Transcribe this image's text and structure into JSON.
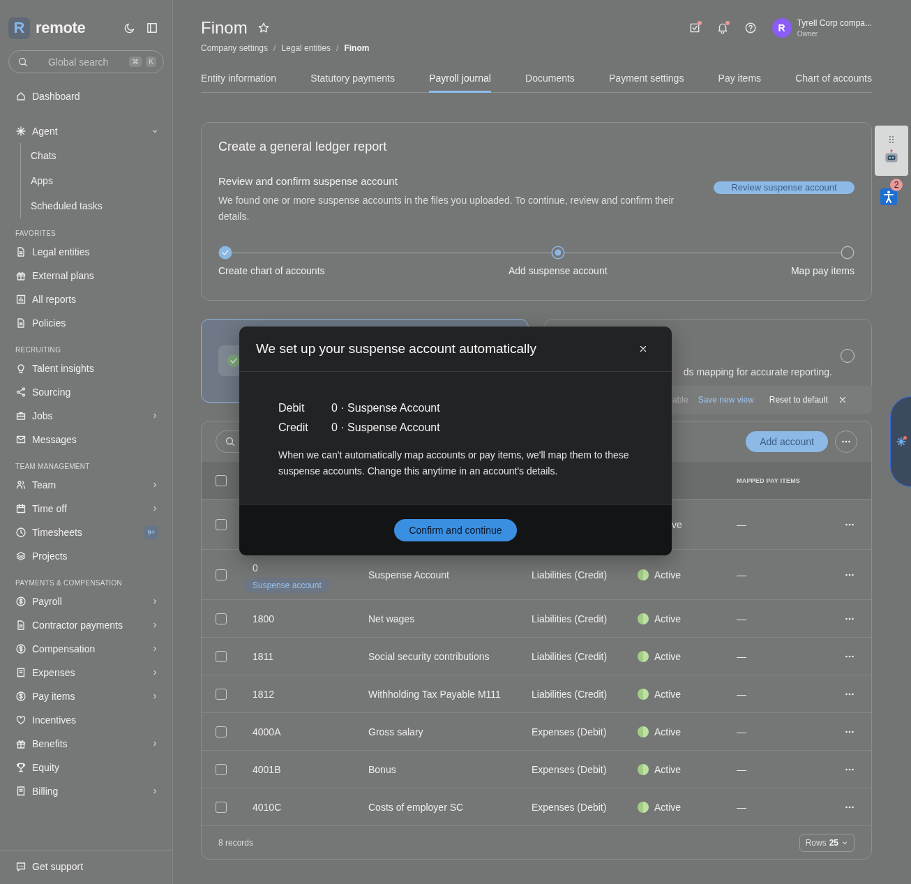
{
  "sidebar": {
    "brand": {
      "logo_letter": "R",
      "name": "remote"
    },
    "search": {
      "placeholder": "Global search",
      "keys": [
        "⌘",
        "K"
      ]
    },
    "sections": [
      {
        "items": [
          {
            "label": "Dashboard",
            "submenu": false
          }
        ]
      },
      {
        "items": [
          {
            "label": "Agent",
            "expanded": true,
            "children": [
              {
                "label": "Chats"
              },
              {
                "label": "Apps"
              },
              {
                "label": "Scheduled tasks"
              }
            ]
          }
        ]
      },
      {
        "heading": "FAVORITES",
        "items": [
          {
            "label": "Legal entities",
            "submenu": false
          },
          {
            "label": "External plans",
            "submenu": false
          },
          {
            "label": "All reports",
            "submenu": false
          },
          {
            "label": "Policies",
            "submenu": false
          }
        ]
      },
      {
        "heading": "RECRUITING",
        "items": [
          {
            "label": "Talent insights",
            "submenu": false
          },
          {
            "label": "Sourcing",
            "submenu": false
          },
          {
            "label": "Jobs",
            "submenu": true
          },
          {
            "label": "Messages",
            "submenu": false
          }
        ]
      },
      {
        "heading": "TEAM MANAGEMENT",
        "items": [
          {
            "label": "Team",
            "submenu": true
          },
          {
            "label": "Time off",
            "submenu": true
          },
          {
            "label": "Timesheets",
            "submenu": false,
            "badge": "9+"
          },
          {
            "label": "Projects",
            "submenu": false
          }
        ]
      },
      {
        "heading": "PAYMENTS & COMPENSATION",
        "items": [
          {
            "label": "Payroll",
            "submenu": true
          },
          {
            "label": "Contractor payments",
            "submenu": true
          },
          {
            "label": "Compensation",
            "submenu": true
          },
          {
            "label": "Expenses",
            "submenu": true
          },
          {
            "label": "Pay items",
            "submenu": true
          },
          {
            "label": "Incentives",
            "submenu": false
          },
          {
            "label": "Benefits",
            "submenu": true
          },
          {
            "label": "Equity",
            "submenu": false
          },
          {
            "label": "Billing",
            "submenu": true
          }
        ]
      }
    ],
    "footer": {
      "label": "Get support"
    }
  },
  "header": {
    "title": "Finom",
    "breadcrumb_separator": "/",
    "breadcrumbs": [
      "Company settings",
      "Legal entities",
      "Finom"
    ],
    "notifications": [
      {
        "kind": "tasks",
        "unread": true
      },
      {
        "kind": "bell",
        "unread": true
      },
      {
        "kind": "help",
        "unread": false
      }
    ],
    "user": {
      "avatar_letter": "R",
      "name": "Tyrell Corp compa...",
      "role": "Owner"
    }
  },
  "tabs": [
    {
      "label": "Entity information",
      "selected": false
    },
    {
      "label": "Statutory payments",
      "selected": false
    },
    {
      "label": "Payroll journal",
      "selected": true
    },
    {
      "label": "Documents",
      "selected": false
    },
    {
      "label": "Payment settings",
      "selected": false
    },
    {
      "label": "Pay items",
      "selected": false
    },
    {
      "label": "Chart of accounts",
      "selected": false
    }
  ],
  "accessibility_widget": {
    "badge": "2"
  },
  "report_card": {
    "title": "Create a general ledger report",
    "subtitle": "Review and confirm suspense account",
    "description": "We found one or more suspense accounts in the files you uploaded. To continue, review and confirm their details.",
    "button": "Review suspense account",
    "steps": [
      {
        "label": "Create chart of accounts",
        "completed": true
      },
      {
        "label": "Add suspense account",
        "completed": false
      },
      {
        "label": "Map pay items",
        "completed": false
      }
    ]
  },
  "option_cards": [
    {
      "selected": true,
      "done": true
    },
    {
      "selected": false,
      "text": "ds mapping for accurate reporting.",
      "done": false
    }
  ],
  "view_bar": {
    "text": "able",
    "link": "Save new view",
    "reset": "Reset to default"
  },
  "table": {
    "add_button": "Add account",
    "header": {
      "checked": false,
      "column_6": "MAPPED PAY ITEMS"
    },
    "rows": [
      {
        "kind": "partial",
        "checked": false,
        "status": "ve",
        "mapped": "—"
      },
      {
        "kind": "full",
        "checked": false,
        "code": "0",
        "tag": "Suspense account",
        "name": "Suspense Account",
        "type": "Liabilities (Credit)",
        "status": "Active",
        "mapped": "—"
      },
      {
        "kind": "full",
        "checked": false,
        "code": "1800",
        "name": "Net wages",
        "type": "Liabilities (Credit)",
        "status": "Active",
        "mapped": "—"
      },
      {
        "kind": "full",
        "checked": false,
        "code": "1811",
        "name": "Social security contributions",
        "type": "Liabilities (Credit)",
        "status": "Active",
        "mapped": "—"
      },
      {
        "kind": "full",
        "checked": false,
        "code": "1812",
        "name": "Withholding Tax Payable M111",
        "type": "Liabilities (Credit)",
        "status": "Active",
        "mapped": "—"
      },
      {
        "kind": "full",
        "checked": false,
        "code": "4000A",
        "name": "Gross salary",
        "type": "Expenses (Debit)",
        "status": "Active",
        "mapped": "—"
      },
      {
        "kind": "full",
        "checked": false,
        "code": "4001B",
        "name": "Bonus",
        "type": "Expenses (Debit)",
        "status": "Active",
        "mapped": "—"
      },
      {
        "kind": "full",
        "checked": false,
        "code": "4010C",
        "name": "Costs of employer SC",
        "type": "Expenses (Debit)",
        "status": "Active",
        "mapped": "—"
      }
    ],
    "records": "8 records",
    "rows_label": "Rows",
    "rows_value": "25"
  },
  "modal": {
    "title": "We set up your suspense account automatically",
    "lines": [
      {
        "label": "Debit",
        "value": "0 · Suspense Account"
      },
      {
        "label": "Credit",
        "value": "0 · Suspense Account"
      }
    ],
    "note": "When we can't automatically map accounts or pay items, we'll map them to these suspense accounts. Change this anytime in an account's details.",
    "button": "Confirm and continue"
  },
  "agent_launcher": {
    "unread": true
  }
}
